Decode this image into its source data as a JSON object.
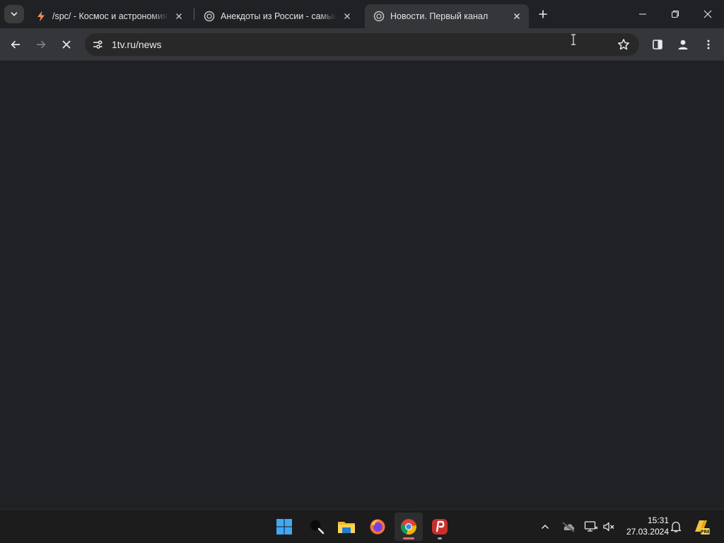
{
  "tabs": [
    {
      "title": "/spc/ - Космос и астрономия",
      "favicon": "lightning-icon",
      "active": false
    },
    {
      "title": "Анекдоты из России - самые с",
      "favicon": "globe-icon",
      "active": false
    },
    {
      "title": "Новости. Первый канал",
      "favicon": "globe-icon",
      "active": true
    }
  ],
  "toolbar": {
    "url": "1tv.ru/news",
    "loading": true
  },
  "taskbar": {
    "apps": [
      "windows-start",
      "search",
      "file-explorer",
      "firefox",
      "chrome",
      "psiphon"
    ],
    "time": "15:31",
    "date": "27.03.2024"
  },
  "colors": {
    "background": "#202124",
    "toolbar": "#35363a",
    "taskbar": "#1c1c1c",
    "chrome_indicator": "#e06c75"
  }
}
